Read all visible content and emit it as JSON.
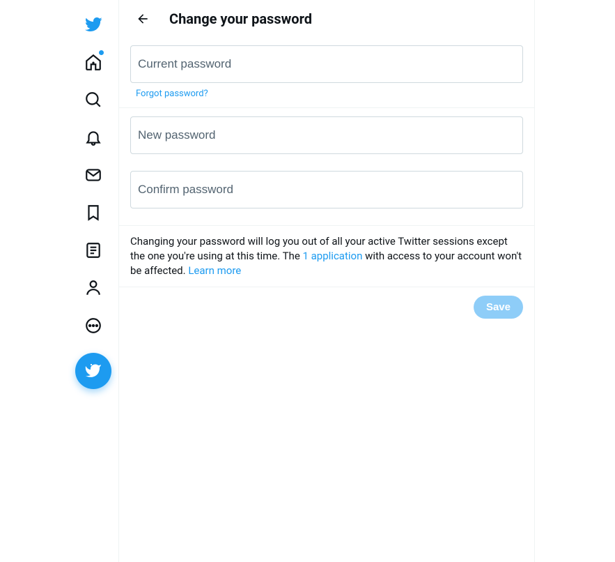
{
  "header": {
    "title": "Change your password"
  },
  "fields": {
    "current_placeholder": "Current password",
    "forgot_link": "Forgot password?",
    "new_placeholder": "New password",
    "confirm_placeholder": "Confirm password"
  },
  "info": {
    "text_before": "Changing your password will log you out of all your active Twitter sessions except the one you're using at this time. The ",
    "link_apps": "1 application",
    "text_mid": " with access to your account won't be affected. ",
    "link_learn": "Learn more"
  },
  "save": {
    "label": "Save"
  }
}
